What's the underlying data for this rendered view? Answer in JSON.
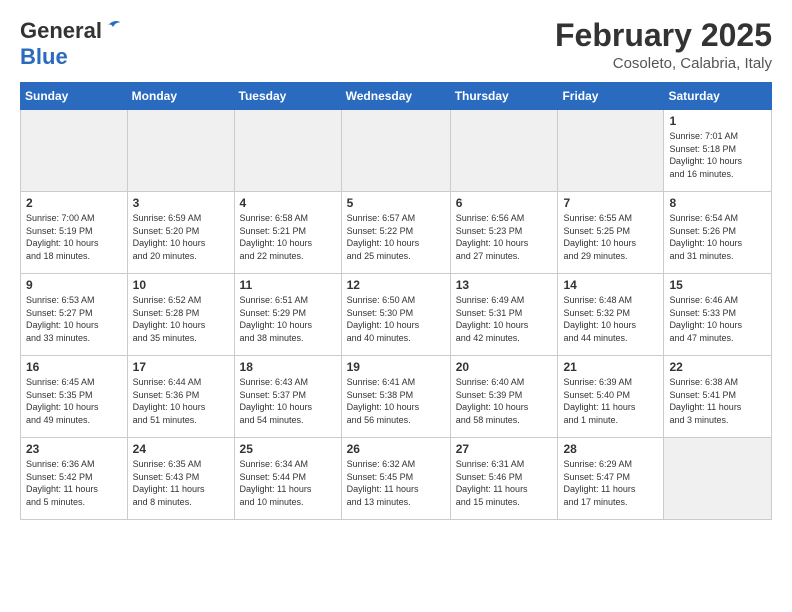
{
  "header": {
    "logo_line1": "General",
    "logo_line2": "Blue",
    "title": "February 2025",
    "subtitle": "Cosoleto, Calabria, Italy"
  },
  "weekdays": [
    "Sunday",
    "Monday",
    "Tuesday",
    "Wednesday",
    "Thursday",
    "Friday",
    "Saturday"
  ],
  "weeks": [
    [
      {
        "day": "",
        "info": ""
      },
      {
        "day": "",
        "info": ""
      },
      {
        "day": "",
        "info": ""
      },
      {
        "day": "",
        "info": ""
      },
      {
        "day": "",
        "info": ""
      },
      {
        "day": "",
        "info": ""
      },
      {
        "day": "1",
        "info": "Sunrise: 7:01 AM\nSunset: 5:18 PM\nDaylight: 10 hours\nand 16 minutes."
      }
    ],
    [
      {
        "day": "2",
        "info": "Sunrise: 7:00 AM\nSunset: 5:19 PM\nDaylight: 10 hours\nand 18 minutes."
      },
      {
        "day": "3",
        "info": "Sunrise: 6:59 AM\nSunset: 5:20 PM\nDaylight: 10 hours\nand 20 minutes."
      },
      {
        "day": "4",
        "info": "Sunrise: 6:58 AM\nSunset: 5:21 PM\nDaylight: 10 hours\nand 22 minutes."
      },
      {
        "day": "5",
        "info": "Sunrise: 6:57 AM\nSunset: 5:22 PM\nDaylight: 10 hours\nand 25 minutes."
      },
      {
        "day": "6",
        "info": "Sunrise: 6:56 AM\nSunset: 5:23 PM\nDaylight: 10 hours\nand 27 minutes."
      },
      {
        "day": "7",
        "info": "Sunrise: 6:55 AM\nSunset: 5:25 PM\nDaylight: 10 hours\nand 29 minutes."
      },
      {
        "day": "8",
        "info": "Sunrise: 6:54 AM\nSunset: 5:26 PM\nDaylight: 10 hours\nand 31 minutes."
      }
    ],
    [
      {
        "day": "9",
        "info": "Sunrise: 6:53 AM\nSunset: 5:27 PM\nDaylight: 10 hours\nand 33 minutes."
      },
      {
        "day": "10",
        "info": "Sunrise: 6:52 AM\nSunset: 5:28 PM\nDaylight: 10 hours\nand 35 minutes."
      },
      {
        "day": "11",
        "info": "Sunrise: 6:51 AM\nSunset: 5:29 PM\nDaylight: 10 hours\nand 38 minutes."
      },
      {
        "day": "12",
        "info": "Sunrise: 6:50 AM\nSunset: 5:30 PM\nDaylight: 10 hours\nand 40 minutes."
      },
      {
        "day": "13",
        "info": "Sunrise: 6:49 AM\nSunset: 5:31 PM\nDaylight: 10 hours\nand 42 minutes."
      },
      {
        "day": "14",
        "info": "Sunrise: 6:48 AM\nSunset: 5:32 PM\nDaylight: 10 hours\nand 44 minutes."
      },
      {
        "day": "15",
        "info": "Sunrise: 6:46 AM\nSunset: 5:33 PM\nDaylight: 10 hours\nand 47 minutes."
      }
    ],
    [
      {
        "day": "16",
        "info": "Sunrise: 6:45 AM\nSunset: 5:35 PM\nDaylight: 10 hours\nand 49 minutes."
      },
      {
        "day": "17",
        "info": "Sunrise: 6:44 AM\nSunset: 5:36 PM\nDaylight: 10 hours\nand 51 minutes."
      },
      {
        "day": "18",
        "info": "Sunrise: 6:43 AM\nSunset: 5:37 PM\nDaylight: 10 hours\nand 54 minutes."
      },
      {
        "day": "19",
        "info": "Sunrise: 6:41 AM\nSunset: 5:38 PM\nDaylight: 10 hours\nand 56 minutes."
      },
      {
        "day": "20",
        "info": "Sunrise: 6:40 AM\nSunset: 5:39 PM\nDaylight: 10 hours\nand 58 minutes."
      },
      {
        "day": "21",
        "info": "Sunrise: 6:39 AM\nSunset: 5:40 PM\nDaylight: 11 hours\nand 1 minute."
      },
      {
        "day": "22",
        "info": "Sunrise: 6:38 AM\nSunset: 5:41 PM\nDaylight: 11 hours\nand 3 minutes."
      }
    ],
    [
      {
        "day": "23",
        "info": "Sunrise: 6:36 AM\nSunset: 5:42 PM\nDaylight: 11 hours\nand 5 minutes."
      },
      {
        "day": "24",
        "info": "Sunrise: 6:35 AM\nSunset: 5:43 PM\nDaylight: 11 hours\nand 8 minutes."
      },
      {
        "day": "25",
        "info": "Sunrise: 6:34 AM\nSunset: 5:44 PM\nDaylight: 11 hours\nand 10 minutes."
      },
      {
        "day": "26",
        "info": "Sunrise: 6:32 AM\nSunset: 5:45 PM\nDaylight: 11 hours\nand 13 minutes."
      },
      {
        "day": "27",
        "info": "Sunrise: 6:31 AM\nSunset: 5:46 PM\nDaylight: 11 hours\nand 15 minutes."
      },
      {
        "day": "28",
        "info": "Sunrise: 6:29 AM\nSunset: 5:47 PM\nDaylight: 11 hours\nand 17 minutes."
      },
      {
        "day": "",
        "info": ""
      }
    ]
  ]
}
